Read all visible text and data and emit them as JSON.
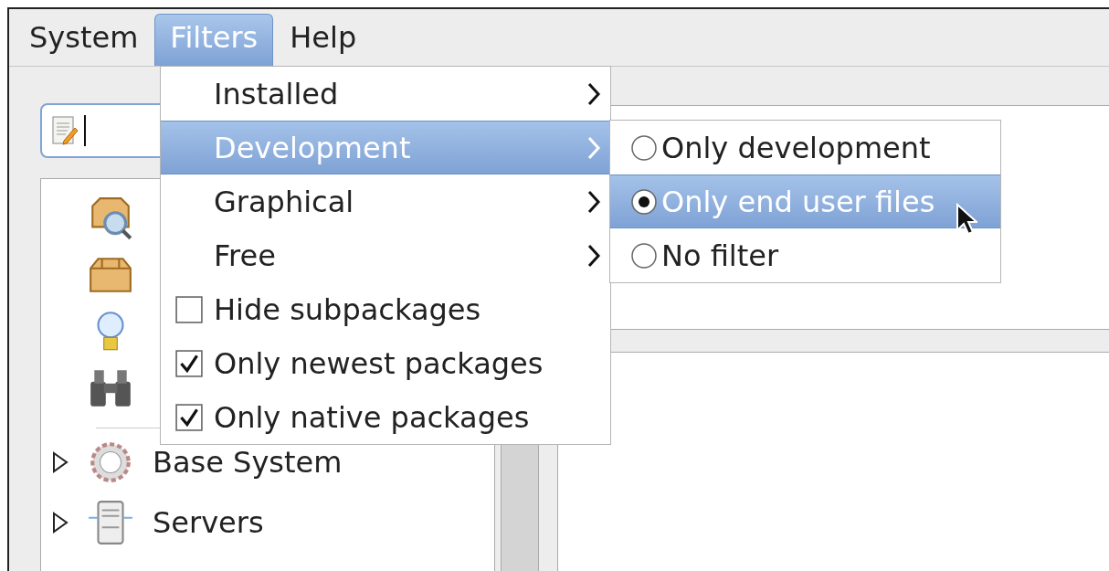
{
  "menubar": [
    {
      "label": "System",
      "selected": false
    },
    {
      "label": "Filters",
      "selected": true
    },
    {
      "label": "Help",
      "selected": false
    }
  ],
  "filters_menu": {
    "items": [
      {
        "kind": "submenu",
        "label": "Installed",
        "selected": false
      },
      {
        "kind": "submenu",
        "label": "Development",
        "selected": true
      },
      {
        "kind": "submenu",
        "label": "Graphical",
        "selected": false
      },
      {
        "kind": "submenu",
        "label": "Free",
        "selected": false
      },
      {
        "kind": "check",
        "label": "Hide subpackages",
        "checked": false
      },
      {
        "kind": "check",
        "label": "Only newest packages",
        "checked": true
      },
      {
        "kind": "check",
        "label": "Only native packages",
        "checked": true
      }
    ]
  },
  "development_submenu": {
    "items": [
      {
        "label": "Only development",
        "checked": false,
        "selected": false
      },
      {
        "label": "Only end user files",
        "checked": true,
        "selected": true
      },
      {
        "label": "No filter",
        "checked": false,
        "selected": false
      }
    ]
  },
  "tree": {
    "items": [
      {
        "label": "Base System",
        "expanded": false
      },
      {
        "label": "Servers",
        "expanded": false
      }
    ]
  }
}
